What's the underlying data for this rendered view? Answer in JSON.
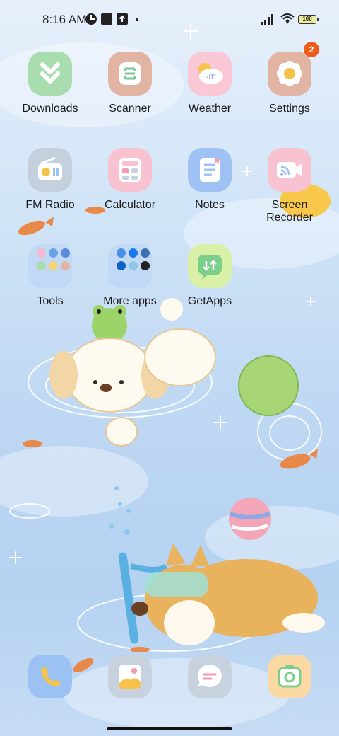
{
  "status_bar": {
    "time": "8:16 AM",
    "battery": "100",
    "icons": [
      "data-saver-icon",
      "app-notification-icon",
      "upload-icon",
      "dot-icon",
      "signal-icon",
      "wifi-icon",
      "battery-icon"
    ]
  },
  "apps": [
    {
      "label": "Downloads",
      "icon": "downloads-icon",
      "color": "#a9dcae"
    },
    {
      "label": "Scanner",
      "icon": "scanner-icon",
      "color": "#e2b4a4"
    },
    {
      "label": "Weather",
      "icon": "weather-icon",
      "color": "#f9c8d4",
      "icon_text": "-8°"
    },
    {
      "label": "Settings",
      "icon": "settings-icon",
      "color": "#e2b4a4",
      "badge": "2"
    },
    {
      "label": "FM Radio",
      "icon": "radio-icon",
      "color": "#c4d0dc"
    },
    {
      "label": "Calculator",
      "icon": "calculator-icon",
      "color": "#f9c2d0"
    },
    {
      "label": "Notes",
      "icon": "notes-icon",
      "color": "#9ec2f4"
    },
    {
      "label": "Screen\nRecorder",
      "label_line1": "Screen",
      "label_line2": "Recorder",
      "icon": "screen-recorder-icon",
      "color": "#f9c2d0"
    },
    {
      "label": "Tools",
      "icon": "folder-icon"
    },
    {
      "label": "More apps",
      "icon": "folder-icon"
    },
    {
      "label": "GetApps",
      "icon": "getapps-icon",
      "color": "#d8f0a8"
    }
  ],
  "dock": [
    {
      "name": "phone",
      "icon": "phone-icon",
      "color": "#9cc2f4"
    },
    {
      "name": "gallery",
      "icon": "gallery-icon",
      "color": "#c8d2de"
    },
    {
      "name": "messages",
      "icon": "messages-icon",
      "color": "#c8d2de"
    },
    {
      "name": "camera",
      "icon": "camera-icon",
      "color": "#fbd9a4"
    }
  ]
}
